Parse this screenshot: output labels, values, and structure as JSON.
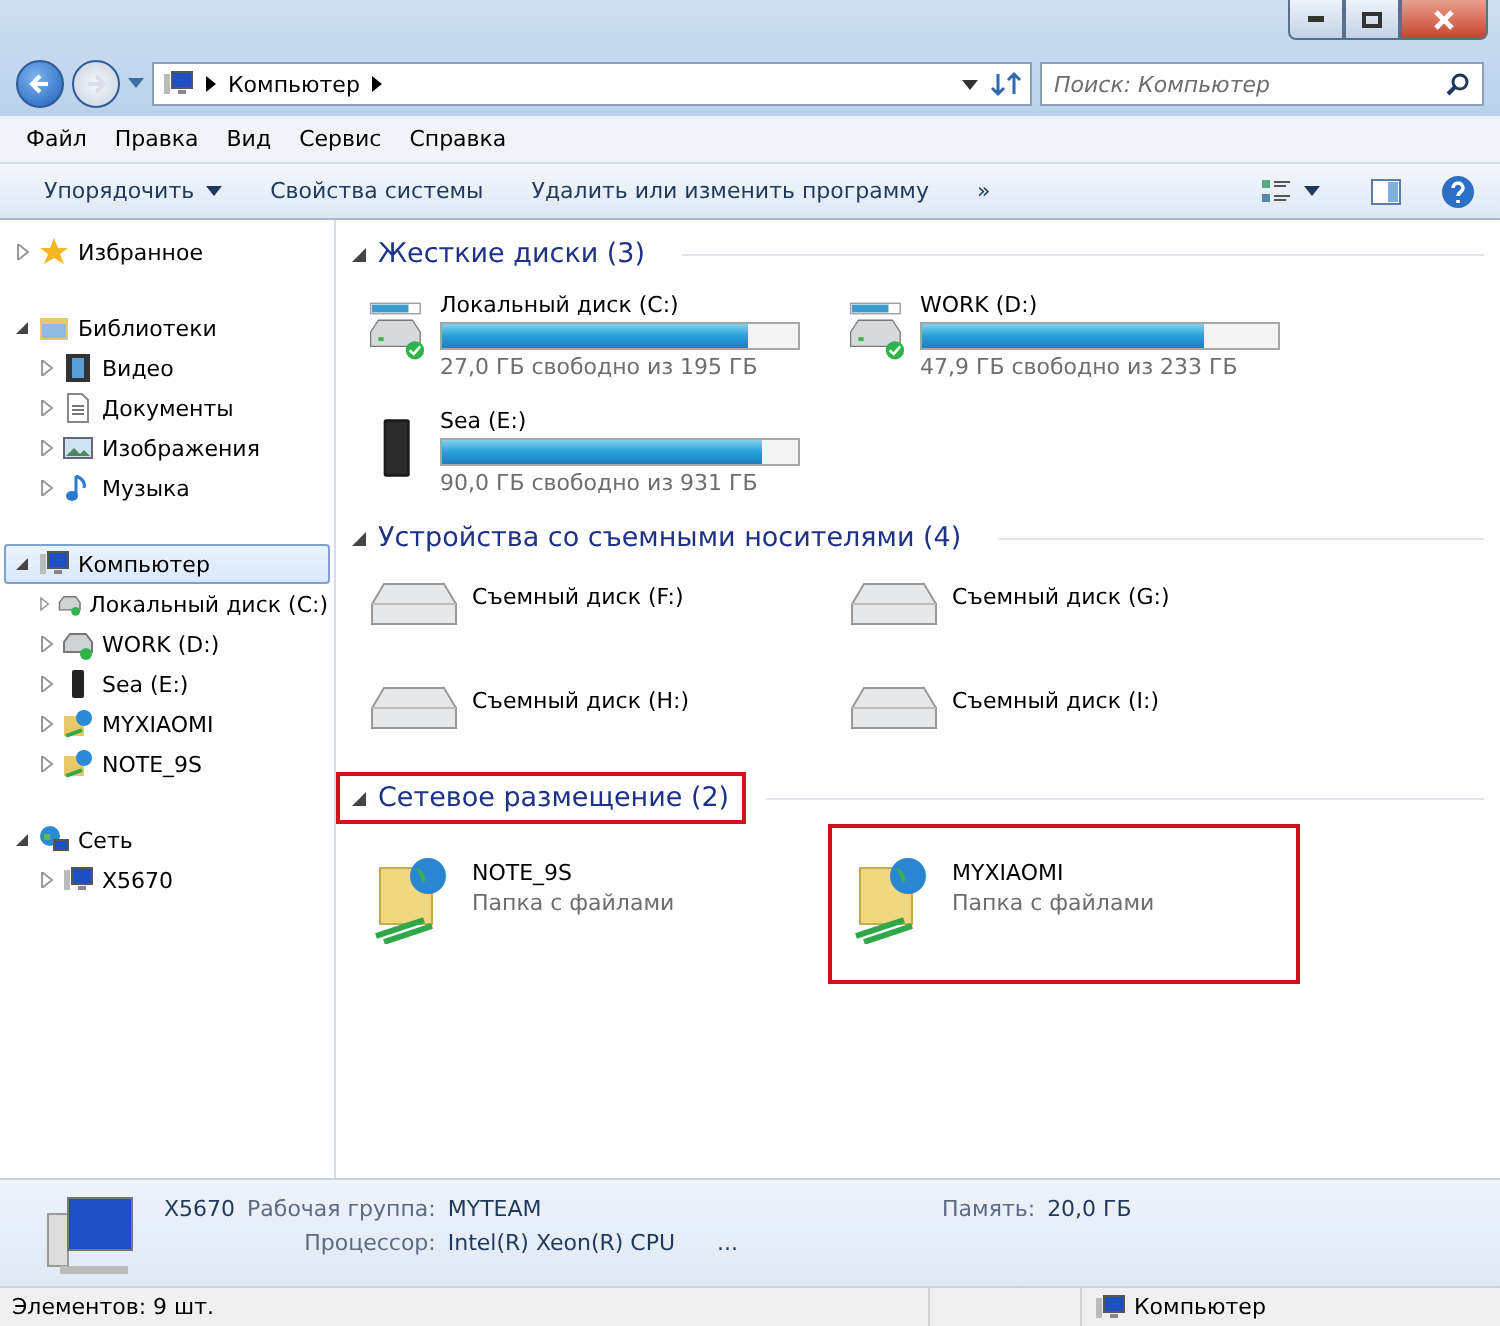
{
  "address": {
    "path": [
      "Компьютер"
    ],
    "search_placeholder": "Поиск: Компьютер"
  },
  "menu": [
    "Файл",
    "Правка",
    "Вид",
    "Сервис",
    "Справка"
  ],
  "commands": [
    {
      "label": "Упорядочить",
      "kind": "dropdown"
    },
    {
      "label": "Свойства системы",
      "kind": "plain"
    },
    {
      "label": "Удалить или изменить программу",
      "kind": "plain"
    },
    {
      "label": "»",
      "kind": "more"
    }
  ],
  "sidebar": [
    {
      "label": "Избранное",
      "kind": "favorites",
      "expanded": false,
      "selected": false
    },
    {
      "label": "Библиотеки",
      "kind": "libraries",
      "expanded": true,
      "selected": false,
      "children": [
        {
          "label": "Видео",
          "kind": "video",
          "expanded": false,
          "selected": false
        },
        {
          "label": "Документы",
          "kind": "documents",
          "expanded": false,
          "selected": false
        },
        {
          "label": "Изображения",
          "kind": "images",
          "expanded": false,
          "selected": false
        },
        {
          "label": "Музыка",
          "kind": "music",
          "expanded": false,
          "selected": false
        }
      ]
    },
    {
      "label": "Компьютер",
      "kind": "computer",
      "expanded": true,
      "selected": true,
      "children": [
        {
          "label": "Локальный диск (C:)",
          "kind": "drive",
          "expanded": false,
          "selected": false
        },
        {
          "label": "WORK (D:)",
          "kind": "drive",
          "expanded": false,
          "selected": false
        },
        {
          "label": "Sea (E:)",
          "kind": "external",
          "expanded": false,
          "selected": false
        },
        {
          "label": "MYXIAOMI",
          "kind": "share",
          "expanded": false,
          "selected": false
        },
        {
          "label": "NOTE_9S",
          "kind": "share",
          "expanded": false,
          "selected": false
        }
      ]
    },
    {
      "label": "Сеть",
      "kind": "network",
      "expanded": true,
      "selected": false,
      "children": [
        {
          "label": "X5670",
          "kind": "computer",
          "expanded": false,
          "selected": false
        }
      ]
    }
  ],
  "groups": [
    {
      "title": "Жесткие диски (3)",
      "highlighted": false,
      "items": [
        {
          "kind": "drive",
          "name": "Локальный диск (C:)",
          "level": 0.86,
          "info": "27,0 ГБ свободно из 195 ГБ",
          "highlighted": false
        },
        {
          "kind": "drive",
          "name": "WORK (D:)",
          "level": 0.79,
          "info": "47,9 ГБ свободно из 233 ГБ",
          "highlighted": false
        },
        {
          "kind": "external",
          "name": "Sea (E:)",
          "level": 0.9,
          "info": "90,0 ГБ свободно из 931 ГБ",
          "highlighted": false
        }
      ]
    },
    {
      "title": "Устройства со съемными носителями (4)",
      "highlighted": false,
      "items": [
        {
          "kind": "removable",
          "name": "Съемный диск (F:)",
          "highlighted": false
        },
        {
          "kind": "removable",
          "name": "Съемный диск (G:)",
          "highlighted": false
        },
        {
          "kind": "removable",
          "name": "Съемный диск (H:)",
          "highlighted": false
        },
        {
          "kind": "removable",
          "name": "Съемный диск (I:)",
          "highlighted": false
        }
      ]
    },
    {
      "title": "Сетевое размещение (2)",
      "highlighted": true,
      "items": [
        {
          "kind": "folder",
          "name": "NOTE_9S",
          "info": "Папка с файлами",
          "highlighted": false
        },
        {
          "kind": "folder",
          "name": "MYXIAOMI",
          "info": "Папка с файлами",
          "highlighted": true
        }
      ]
    }
  ],
  "details": {
    "name": "X5670",
    "fields": [
      {
        "label": "Рабочая группа:",
        "value": "MYTEAM"
      },
      {
        "label": "Память:",
        "value": "20,0 ГБ"
      },
      {
        "label": "Процессор:",
        "value": "Intel(R) Xeon(R) CPU      ..."
      }
    ]
  },
  "status_bar": {
    "count": "Элементов: 9 шт.",
    "location": "Компьютер"
  }
}
